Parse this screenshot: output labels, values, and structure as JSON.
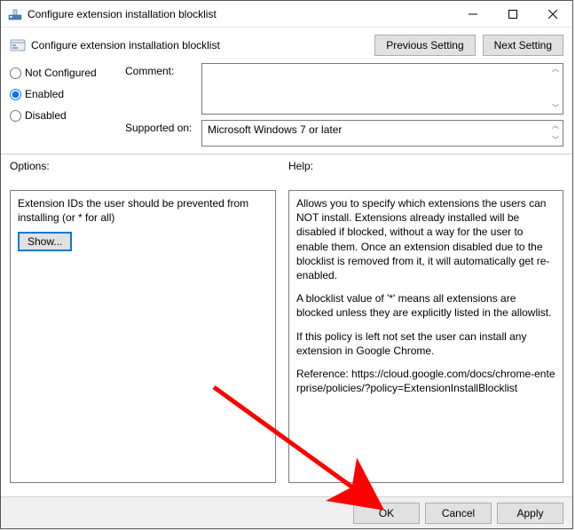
{
  "window": {
    "title": "Configure extension installation blocklist",
    "header_title": "Configure extension installation blocklist"
  },
  "nav": {
    "previous": "Previous Setting",
    "next": "Next Setting"
  },
  "state": {
    "not_configured": "Not Configured",
    "enabled": "Enabled",
    "disabled": "Disabled",
    "selected": "enabled"
  },
  "fields": {
    "comment_label": "Comment:",
    "comment_value": "",
    "supported_label": "Supported on:",
    "supported_value": "Microsoft Windows 7 or later"
  },
  "sections": {
    "options_label": "Options:",
    "help_label": "Help:"
  },
  "options": {
    "description": "Extension IDs the user should be prevented from installing (or * for all)",
    "show_button": "Show..."
  },
  "help": {
    "p1": "Allows you to specify which extensions the users can NOT install. Extensions already installed will be disabled if blocked, without a way for the user to enable them. Once an extension disabled due to the blocklist is removed from it, it will automatically get re-enabled.",
    "p2": "A blocklist value of '*' means all extensions are blocked unless they are explicitly listed in the allowlist.",
    "p3": "If this policy is left not set the user can install any extension in Google Chrome.",
    "p4": "Reference: https://cloud.google.com/docs/chrome-enterprise/policies/?policy=ExtensionInstallBlocklist"
  },
  "footer": {
    "ok": "OK",
    "cancel": "Cancel",
    "apply": "Apply"
  }
}
